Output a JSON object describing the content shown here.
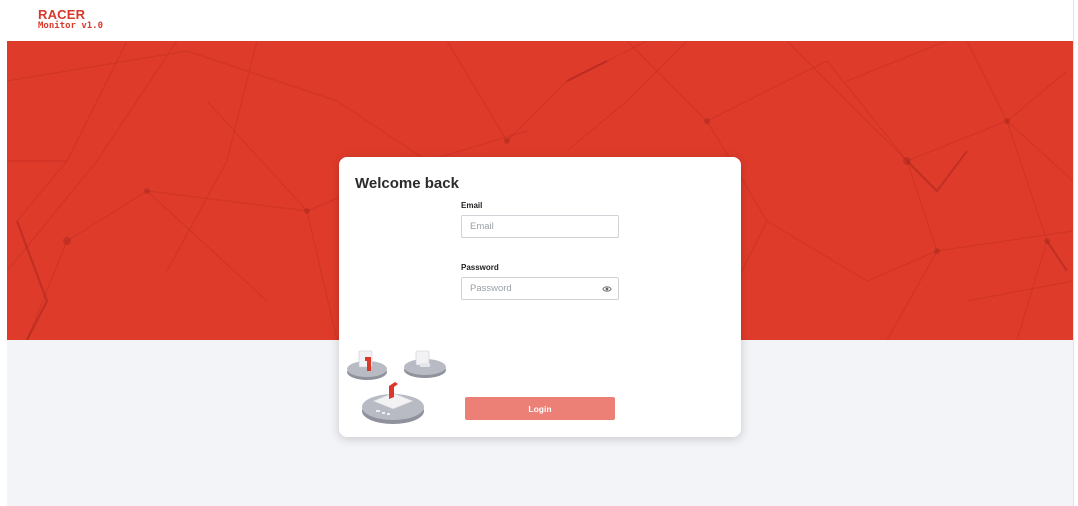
{
  "brand": {
    "name": "RACER",
    "version": "Monitor v1.0"
  },
  "login": {
    "title": "Welcome back",
    "email": {
      "label": "Email",
      "placeholder": "Email",
      "value": ""
    },
    "password": {
      "label": "Password",
      "placeholder": "Password",
      "value": ""
    },
    "submit_label": "Login"
  },
  "colors": {
    "brand": "#d9382a",
    "hero": "#df3b2b",
    "button": "#ec8077",
    "background_lower": "#f3f4f7"
  },
  "icons": {
    "password_toggle": "eye-icon",
    "illustration": "devices-illustration"
  }
}
